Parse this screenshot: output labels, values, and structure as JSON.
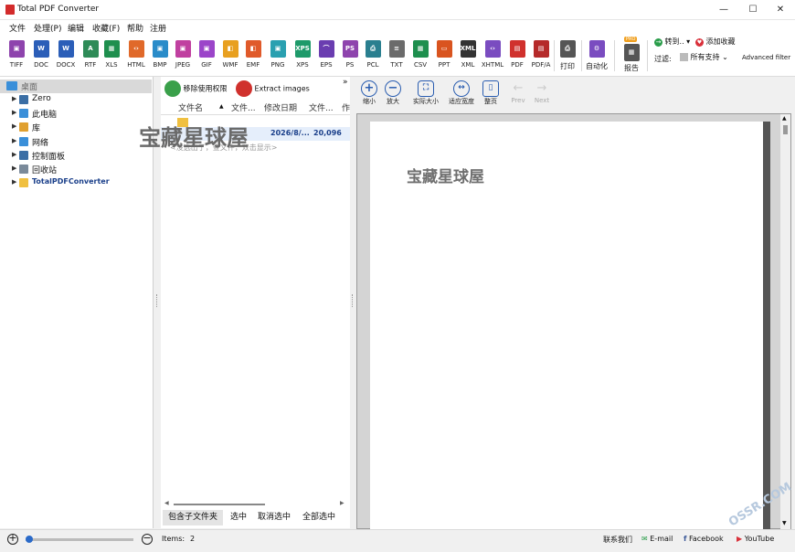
{
  "window": {
    "title": "Total PDF Converter",
    "minimize": "—",
    "maximize": "☐",
    "close": "✕"
  },
  "menu": [
    "文件",
    "处理(P)",
    "编辑",
    "收藏(F)",
    "帮助",
    "注册"
  ],
  "toolbar": {
    "formats": [
      {
        "label": "TIFF",
        "icon": "image-icon",
        "color": "#8e44ad",
        "glyph": "▣"
      },
      {
        "label": "DOC",
        "icon": "word-icon",
        "color": "#2b5eb8",
        "glyph": "W"
      },
      {
        "label": "DOCX",
        "icon": "word-icon",
        "color": "#2b5eb8",
        "glyph": "W"
      },
      {
        "label": "RTF",
        "icon": "rtf-icon",
        "color": "#2e8b57",
        "glyph": "A"
      },
      {
        "label": "XLS",
        "icon": "excel-icon",
        "color": "#1e8f4e",
        "glyph": "▦"
      },
      {
        "label": "HTML",
        "icon": "code-icon",
        "color": "#e0692a",
        "glyph": "‹›"
      },
      {
        "label": "BMP",
        "icon": "image-icon",
        "color": "#2a8cc9",
        "glyph": "▣"
      },
      {
        "label": "JPEG",
        "icon": "image-icon",
        "color": "#c040a0",
        "glyph": "▣"
      },
      {
        "label": "GIF",
        "icon": "image-icon",
        "color": "#9b45c9",
        "glyph": "▣"
      },
      {
        "label": "WMF",
        "icon": "shapes-icon",
        "color": "#e8a020",
        "glyph": "◧"
      },
      {
        "label": "EMF",
        "icon": "shapes-icon",
        "color": "#e05a2a",
        "glyph": "◧"
      },
      {
        "label": "PNG",
        "icon": "image-icon",
        "color": "#2aa0b0",
        "glyph": "▣"
      },
      {
        "label": "XPS",
        "icon": "xps-icon",
        "color": "#1e9a6a",
        "glyph": "XPS"
      },
      {
        "label": "EPS",
        "icon": "curve-icon",
        "color": "#6a3db0",
        "glyph": "⌒"
      },
      {
        "label": "PS",
        "icon": "ps-icon",
        "color": "#8e44ad",
        "glyph": "PS"
      },
      {
        "label": "PCL",
        "icon": "printer-icon",
        "color": "#2a7f8f",
        "glyph": "⎙"
      },
      {
        "label": "TXT",
        "icon": "text-icon",
        "color": "#6b6b6b",
        "glyph": "≡"
      },
      {
        "label": "CSV",
        "icon": "table-icon",
        "color": "#1e8f4e",
        "glyph": "▦"
      },
      {
        "label": "PPT",
        "icon": "ppt-icon",
        "color": "#d9541f",
        "glyph": "▭"
      },
      {
        "label": "XML",
        "icon": "xml-icon",
        "color": "#333333",
        "glyph": "XML"
      },
      {
        "label": "XHTML",
        "icon": "code-icon",
        "color": "#7a4cc0",
        "glyph": "‹›"
      },
      {
        "label": "PDF",
        "icon": "pdf-icon",
        "color": "#d0312d",
        "glyph": "▤"
      },
      {
        "label": "PDF/A",
        "icon": "pdf-icon",
        "color": "#b52a2a",
        "glyph": "▤"
      }
    ],
    "print_label": "打印",
    "automate_label": "自动化",
    "report_label": "报告",
    "report_badge": "PRO",
    "goto_label": "转到..",
    "favorite_label": "添加收藏",
    "filter_label": "过滤:",
    "filter_value": "所有支持",
    "advanced_filter": "Advanced filter"
  },
  "tree": {
    "root": "桌面",
    "items": [
      {
        "label": "Zero",
        "icon": "user-icon",
        "color": "#3a6ea5"
      },
      {
        "label": "此电脑",
        "icon": "computer-icon",
        "color": "#3a8fd9"
      },
      {
        "label": "库",
        "icon": "library-icon",
        "color": "#e0a030"
      },
      {
        "label": "网络",
        "icon": "network-icon",
        "color": "#3a8fd9"
      },
      {
        "label": "控制面板",
        "icon": "control-panel-icon",
        "color": "#3a6ea5"
      },
      {
        "label": "回收站",
        "icon": "recycle-bin-icon",
        "color": "#7a8a9a"
      },
      {
        "label": "TotalPDFConverter",
        "icon": "folder-icon",
        "color": "#f0c040"
      }
    ]
  },
  "filelist": {
    "remove_permissions": "移除使用权限",
    "extract_images": "Extract images",
    "columns": [
      "文件名",
      "文件...",
      "修改日期",
      "文件...",
      "作"
    ],
    "row": {
      "date": "2026/8/...",
      "size": "20,096"
    },
    "hint": "<没选出了，查文件，双击显示>",
    "include_sub": "包含子文件夹",
    "select": "选中",
    "unselect": "取消选中",
    "select_all": "全部选中"
  },
  "preview": {
    "zoom_out": "缩小",
    "zoom_in": "放大",
    "actual_size": "实际大小",
    "fit_width": "适应宽度",
    "full_page": "整页",
    "prev": "Prev",
    "next": "Next",
    "page_text": "宝藏星球屋"
  },
  "watermark": {
    "text": "宝藏星球屋",
    "corner": "OSSR.COM"
  },
  "status": {
    "items_label": "Items:",
    "items_count": "2",
    "contact": "联系我们",
    "email": "E-mail",
    "facebook": "Facebook",
    "youtube": "YouTube"
  }
}
